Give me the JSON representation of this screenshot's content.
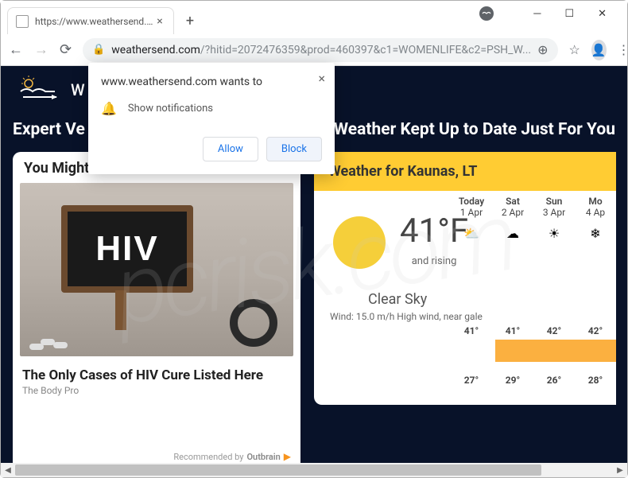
{
  "window": {
    "tab_title": "https://www.weathersend.com/?"
  },
  "toolbar": {
    "url_domain": "weathersend.com",
    "url_path": "/?hitid=2072476359&prod=460397&c1=WOMENLIFE&c2=PSH_W..."
  },
  "notification": {
    "origin": "www.weathersend.com wants to",
    "message": "Show notifications",
    "allow_label": "Allow",
    "block_label": "Block"
  },
  "page": {
    "logo_text": "W",
    "hero_left": "Expert Ve",
    "hero_right": "Weather Kept Up to Date Just For You",
    "you_might_like": "You Might Also Like",
    "ad": {
      "chalk": "HIV",
      "headline": "The Only Cases of HIV Cure Listed Here",
      "source": "The Body Pro",
      "recommended_by": "Recommended by",
      "brand": "Outbrain"
    },
    "weather": {
      "header": "Weather for Kaunas, LT",
      "temp": "41°F",
      "rising": "and rising",
      "condition": "Clear Sky",
      "wind": "Wind: 15.0 m/h High wind, near gale",
      "forecast": [
        {
          "day": "Today",
          "date": "1 Apr",
          "icon": "⛅",
          "hi": "41°",
          "lo": "27°"
        },
        {
          "day": "Sat",
          "date": "2 Apr",
          "icon": "☁",
          "hi": "41°",
          "lo": "29°"
        },
        {
          "day": "Sun",
          "date": "3 Apr",
          "icon": "☀",
          "hi": "42°",
          "lo": "26°"
        },
        {
          "day": "Mo",
          "date": "4 Ap",
          "icon": "❄",
          "hi": "42°",
          "lo": "28°"
        }
      ]
    }
  }
}
